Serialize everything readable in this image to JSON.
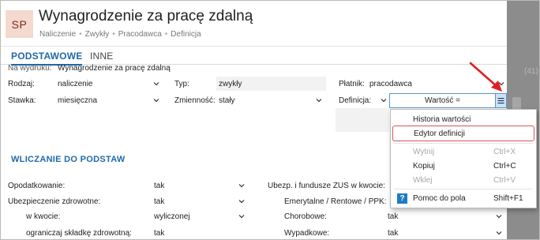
{
  "header": {
    "avatar": "SP",
    "title": "Wynagrodzenie za pracę zdalną",
    "breadcrumbs": [
      "Naliczenie",
      "Zwykły",
      "Pracodawca",
      "Definicja"
    ]
  },
  "tabs": [
    {
      "label": "PODSTAWOWE",
      "active": true
    },
    {
      "label": "INNE",
      "active": false
    }
  ],
  "form": {
    "na_wydruku_label": "Na wydruku:",
    "na_wydruku_value": "Wynagrodzenie za pracę zdalną",
    "rodzaj_label": "Rodzaj:",
    "rodzaj_value": "naliczenie",
    "typ_label": "Typ:",
    "typ_value": "zwykły",
    "platnik_label": "Płatnik:",
    "platnik_value": "pracodawca",
    "stawka_label": "Stawka:",
    "stawka_value": "miesięczna",
    "zmiennosc_label": "Zmienność:",
    "zmiennosc_value": "stały",
    "definicja_label": "Definicja:",
    "wartosc_label": "Wartość ="
  },
  "section": {
    "title": "WLICZANIE DO PODSTAW",
    "opodatkowanie_label": "Opodatkowanie:",
    "opodatkowanie_value": "tak",
    "ubezp_zdrowotne_label": "Ubezpieczenie zdrowotne:",
    "ubezp_zdrowotne_value": "tak",
    "w_kwocie_label": "w kwocie:",
    "w_kwocie_value": "wyliczonej",
    "ogranicz_label": "ograniczaj składkę zdrowotną:",
    "ogranicz_value": "tak",
    "ubezp_zus_label": "Ubezp. i fundusze ZUS w kwocie:",
    "emerytalne_label": "Emerytalne / Rentowe / PPK:",
    "chorobowe_label": "Chorobowe:",
    "chorobowe_value": "tak",
    "wypadkowe_label": "Wypadkowe:",
    "wypadkowe_value": "tak"
  },
  "context_menu": {
    "items": [
      {
        "label": "Historia wartości",
        "shortcut": "",
        "enabled": true
      },
      {
        "label": "Edytor definicji",
        "shortcut": "",
        "enabled": true,
        "highlighted": true
      },
      {
        "label": "Wytnij",
        "shortcut": "Ctrl+X",
        "enabled": false
      },
      {
        "label": "Kopiuj",
        "shortcut": "Ctrl+C",
        "enabled": true
      },
      {
        "label": "Wklej",
        "shortcut": "Ctrl+V",
        "enabled": false
      },
      {
        "label": "Pomoc do pola",
        "shortcut": "Shift+F1",
        "enabled": true
      }
    ]
  },
  "background": {
    "ghost_text": "(41)"
  },
  "colors": {
    "accent": "#1e6aa8",
    "avatar_bg": "#f3d9cf",
    "highlight_border": "#d9535a",
    "arrow": "#e02020",
    "help_icon": "#1f7ac2"
  }
}
